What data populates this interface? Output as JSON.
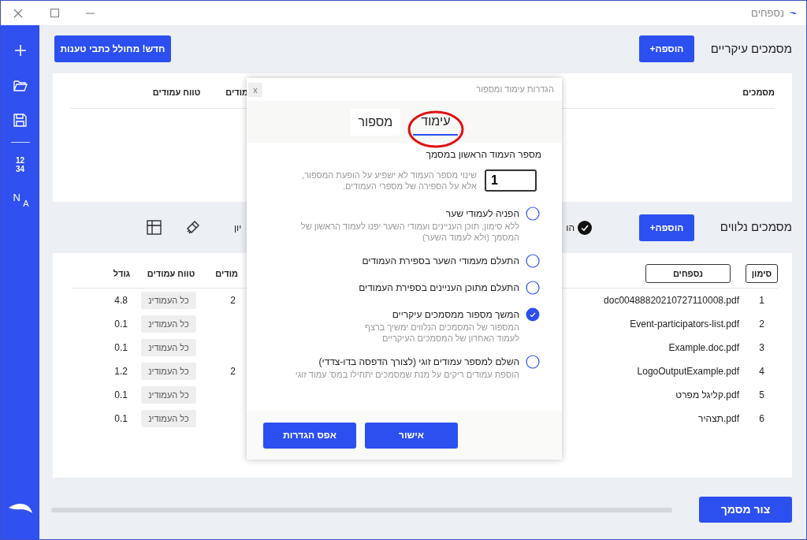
{
  "window": {
    "title": "נספחים"
  },
  "sidebar": {
    "items": [
      {
        "kind": "plus"
      },
      {
        "kind": "folder"
      },
      {
        "kind": "save"
      },
      {
        "kind": "numbers",
        "lines": [
          "12",
          "34"
        ]
      },
      {
        "kind": "letters",
        "lines": [
          "N",
          "A"
        ]
      }
    ]
  },
  "main_documents": {
    "title": "מסמכים עיקריים",
    "add_button": "הוספה+",
    "generator_button": "חדש! מחולל כתבי טענות",
    "columns": [
      "מסמכים",
      "מודים",
      "טווח עמודים"
    ]
  },
  "attached_documents": {
    "title": "מסמכים נלווים",
    "add_button": "הוספה+",
    "toolbar_text_right": "הו",
    "toolbar_text_left": "יון",
    "columns": [
      "סימון",
      "נספחים",
      "מודים",
      "טווח עמודים",
      "גודל"
    ],
    "rows": [
      {
        "mark": "1",
        "name": "doc00488820210727110008.pdf",
        "pages": "2",
        "range": "כל העמודינ",
        "size": "4.8"
      },
      {
        "mark": "2",
        "name": "Event-participators-list.pdf",
        "range": "כל העמודינ",
        "size": "0.1"
      },
      {
        "mark": "3",
        "name": "Example.doc.pdf",
        "range": "כל העמודינ",
        "size": "0.1"
      },
      {
        "mark": "4",
        "name": "LogoOutputExample.pdf",
        "pages": "2",
        "range": "כל העמודינ",
        "size": "1.2"
      },
      {
        "mark": "5",
        "name": "קליגל מפרט.pdf",
        "range": "כל העמודינ",
        "size": "0.1"
      },
      {
        "mark": "6",
        "name": "תצהיר.pdf",
        "range": "כל העמודינ",
        "size": "0.1"
      }
    ]
  },
  "create_button": "צור מסמך",
  "dialog": {
    "title": "הגדרות עימוד ומספור",
    "close": "x",
    "tabs": [
      {
        "label": "עימוד",
        "selected": true
      },
      {
        "label": "מספור",
        "selected": false
      }
    ],
    "first_page": {
      "label": "מספר העמוד הראשון במסמך",
      "value": "1",
      "help": [
        "שינוי מספר העמוד לא ישפיע על הופעת המספור,",
        "אלא על הספירה של מספרי העמודים."
      ]
    },
    "options": [
      {
        "label": "הפניה לעמודי שער",
        "description": [
          "ללא סימון, תוכן העניינים ועמודי השער יפנו לעמוד הראשון של",
          "המסמך (ולא לעמוד השער)"
        ],
        "checked": false
      },
      {
        "label": "התעלם מעמודי השער בספירת העמודים",
        "checked": false
      },
      {
        "label": "התעלם מתוכן העניינים בספירת העמודים",
        "checked": false
      },
      {
        "label": "המשך מספור ממסמכים עיקריים",
        "description": [
          "המספור של המסמכים הנלווים ימשיך ברצף",
          "לעמוד האחרון של המסמכים העיקריים"
        ],
        "checked": true
      },
      {
        "label": "השלם למספר עמודים זוגי (לצורך הדפסה בדו-צדדי)",
        "description": [
          "הוספת עמודים ריקים על מנת שמסמכים יתחילו במס' עמוד זוגי"
        ],
        "checked": false
      }
    ],
    "buttons": [
      "אישור",
      "אפס הגדרות"
    ]
  }
}
